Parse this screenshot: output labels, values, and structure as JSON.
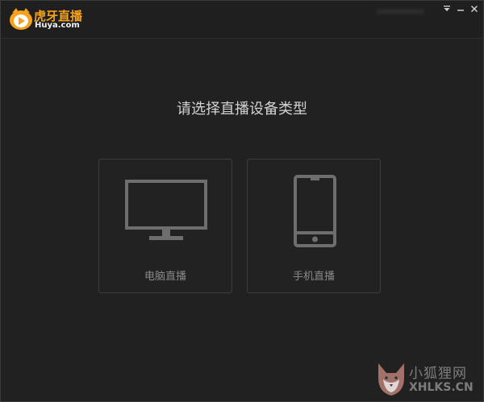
{
  "app": {
    "logo_text": "虎牙直播",
    "logo_subtext": "Huya.com",
    "username_blurred": "xxxxxxxxxxx",
    "brand_color": "#f7a21c"
  },
  "titlebar": {
    "dropdown_icon": "triangle-down-icon",
    "minimize_icon": "minimize-icon",
    "close_icon": "close-icon"
  },
  "main": {
    "title": "请选择直播设备类型",
    "options": [
      {
        "label": "电脑直播",
        "icon": "monitor-icon"
      },
      {
        "label": "手机直播",
        "icon": "phone-icon"
      }
    ]
  },
  "watermark": {
    "text_cn": "小狐狸网",
    "text_en": "XHLKS.CN",
    "icon": "fox-icon"
  }
}
